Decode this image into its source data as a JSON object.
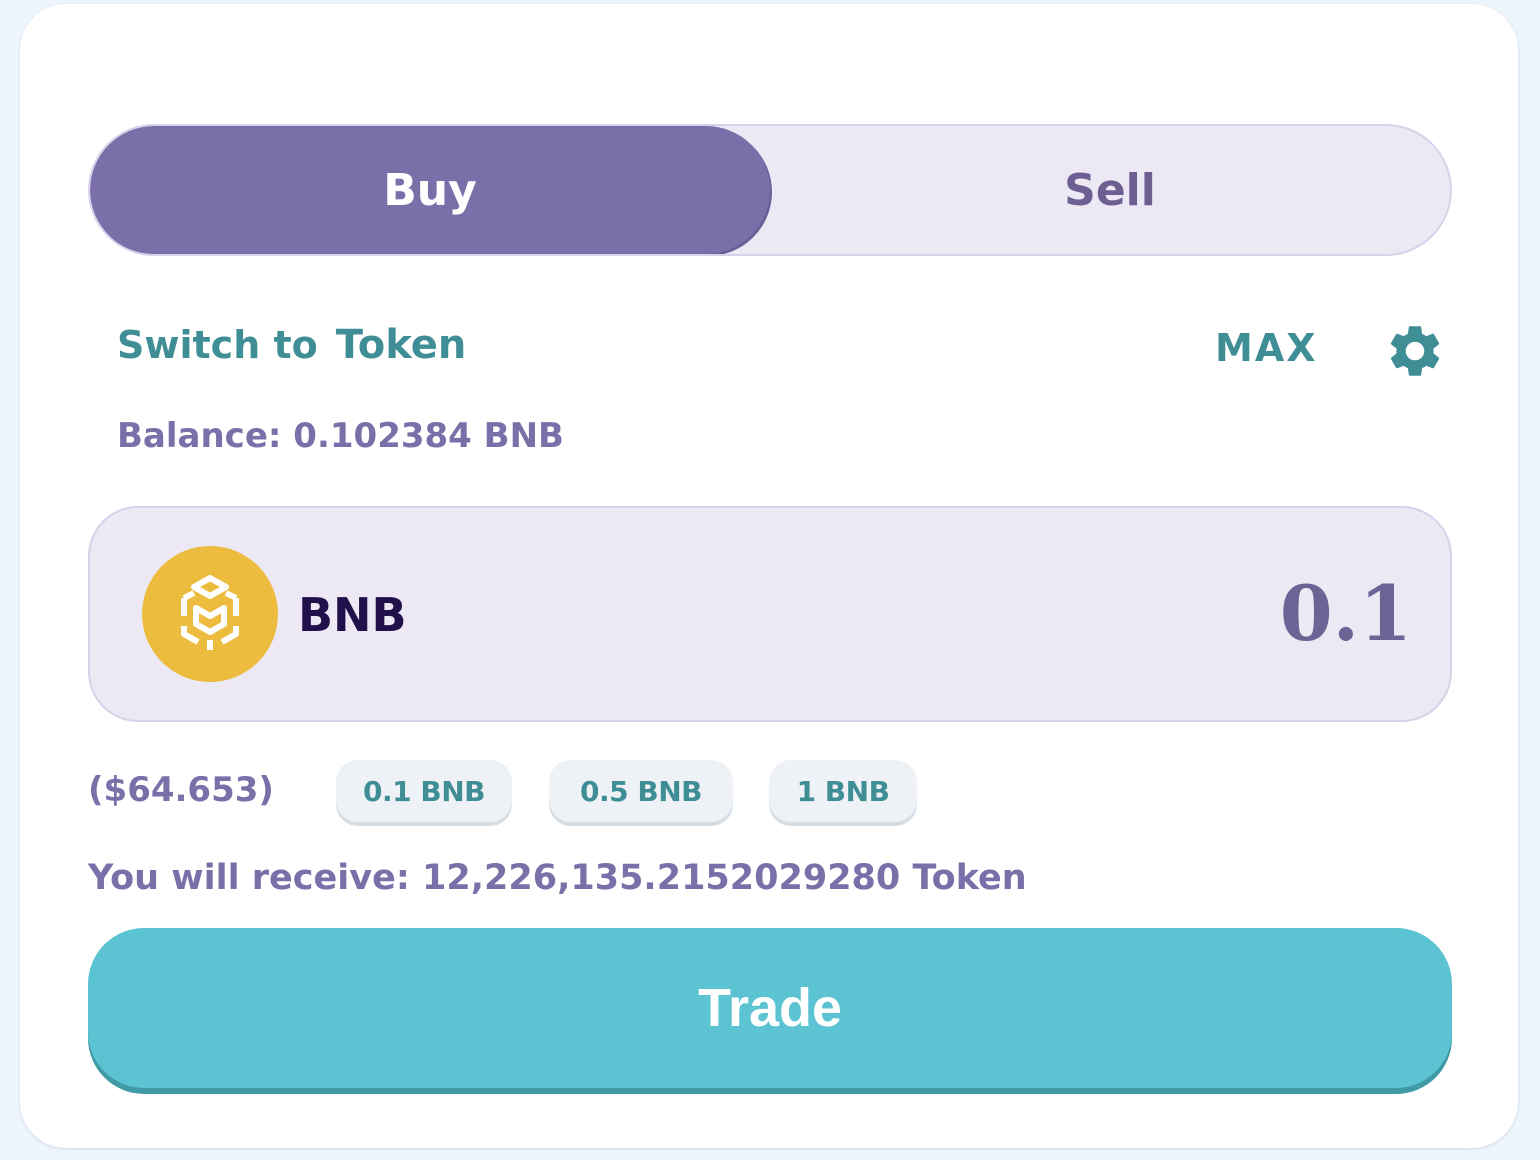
{
  "tabs": {
    "buy": "Buy",
    "sell": "Sell",
    "active": "Buy"
  },
  "switch": {
    "prefix": "Switch to",
    "target": "Token"
  },
  "max_label": "MAX",
  "settings_icon": "gear-icon",
  "balance_text": "Balance: 0.102384 BNB",
  "input": {
    "coin_icon": "bnb-logo-icon",
    "coin_name": "BNB",
    "value": "0.1"
  },
  "usd_value": "($64.653)",
  "presets": [
    "0.1 BNB",
    "0.5 BNB",
    "1 BNB"
  ],
  "receive": {
    "label": "You will receive:",
    "amount": "12,226,135.2152029280",
    "symbol": "Token"
  },
  "trade_label": "Trade",
  "colors": {
    "primary_purple": "#7a6fa8",
    "teal": "#3f8e96",
    "trade_button": "#5cc3d2",
    "bnb_gold": "#ecbc3f",
    "input_bg": "#ece8f4"
  }
}
